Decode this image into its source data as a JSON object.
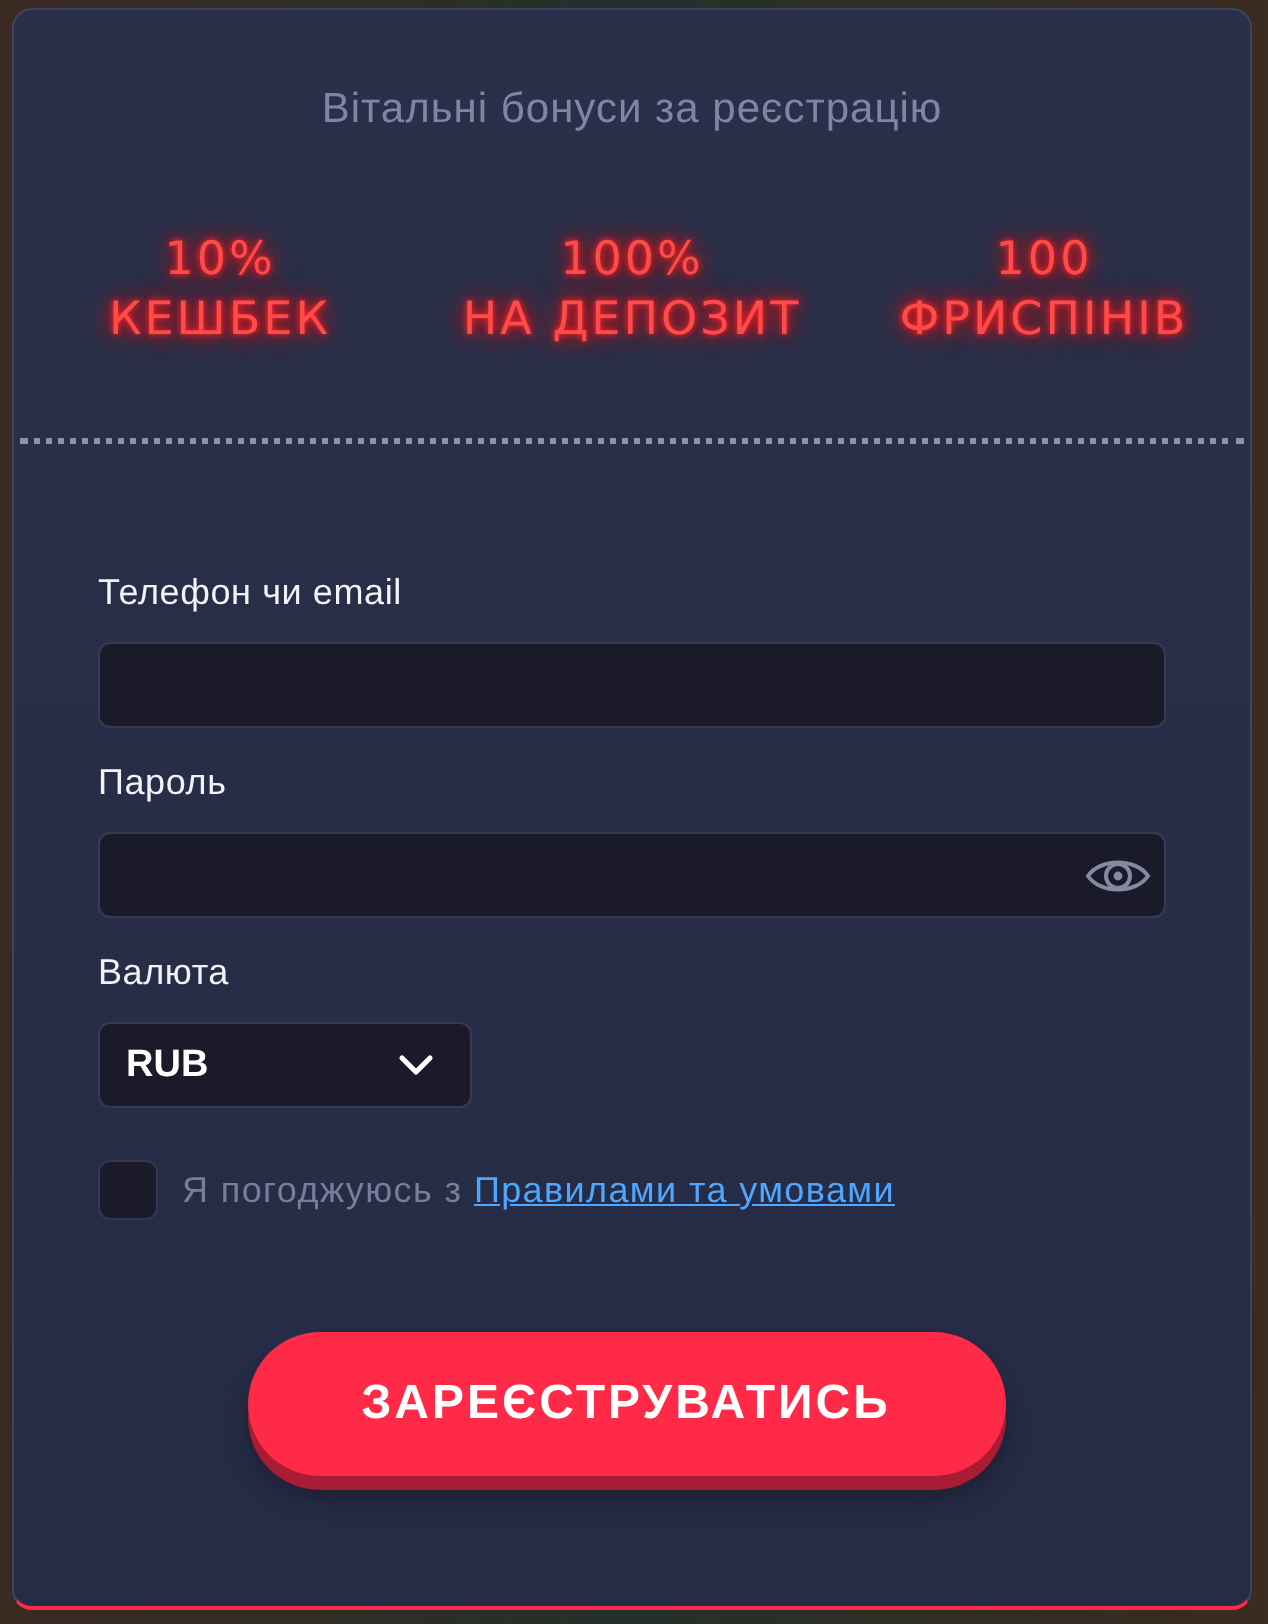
{
  "header": {
    "title": "Вітальні бонуси за реєстрацію"
  },
  "bonuses": [
    {
      "value": "10%",
      "label": "КЕШБЕК"
    },
    {
      "value": "100%",
      "label": "НА ДЕПОЗИТ"
    },
    {
      "value": "100",
      "label": "ФРИСПІНІВ"
    }
  ],
  "form": {
    "fields": [
      {
        "kind": "text",
        "label": "Телефон чи email"
      },
      {
        "kind": "password",
        "label": "Пароль"
      },
      {
        "kind": "select",
        "label": "Валюта",
        "value": "RUB"
      }
    ],
    "agreement": {
      "checked": false,
      "text": "Я погоджуюсь з",
      "link": "Правилами та умовами"
    },
    "submit": "ЗАРЕЄСТРУВАТИСЬ"
  }
}
